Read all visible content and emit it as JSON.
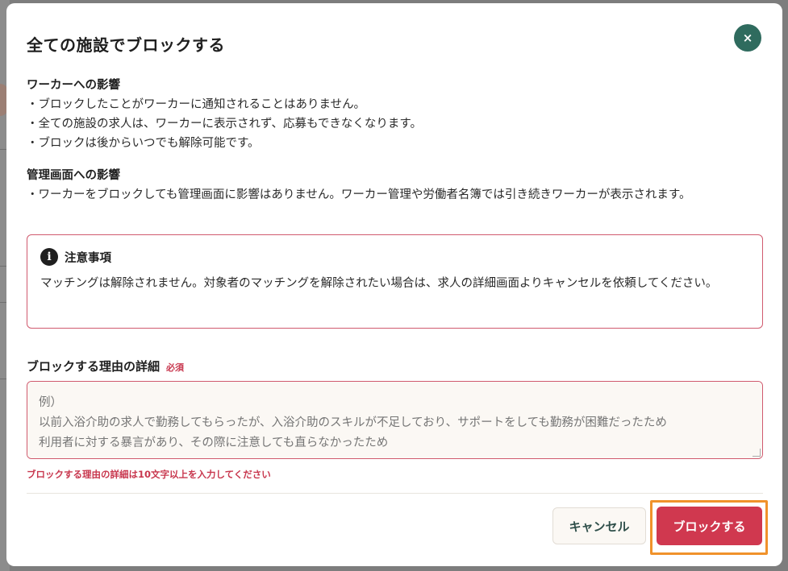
{
  "modal": {
    "title": "全ての施設でブロックする",
    "close_label": "×"
  },
  "worker_impact": {
    "heading": "ワーカーへの影響",
    "items": [
      "・ブロックしたことがワーカーに通知されることはありません。",
      "・全ての施設の求人は、ワーカーに表示されず、応募もできなくなります。",
      "・ブロックは後からいつでも解除可能です。"
    ]
  },
  "admin_impact": {
    "heading": "管理画面への影響",
    "text": "・ワーカーをブロックしても管理画面に影響はありません。ワーカー管理や労働者名簿では引き続きワーカーが表示されます。"
  },
  "notice": {
    "icon": "i",
    "title": "注意事項",
    "body": "マッチングは解除されません。対象者のマッチングを解除されたい場合は、求人の詳細画面よりキャンセルを依頼してください。"
  },
  "reason": {
    "label": "ブロックする理由の詳細",
    "required": "必須",
    "value": "",
    "placeholder": "例）\n以前入浴介助の求人で勤務してもらったが、入浴介助のスキルが不足しており、サポートをしても勤務が困難だったため\n利用者に対する暴言があり、その際に注意しても直らなかったため",
    "error": "ブロックする理由の詳細は10文字以上を入力してください"
  },
  "actions": {
    "cancel": "キャンセル",
    "block": "ブロックする"
  },
  "colors": {
    "accent": "#d0384f",
    "close_button": "#2f6b5e",
    "highlight": "#f0922b"
  }
}
